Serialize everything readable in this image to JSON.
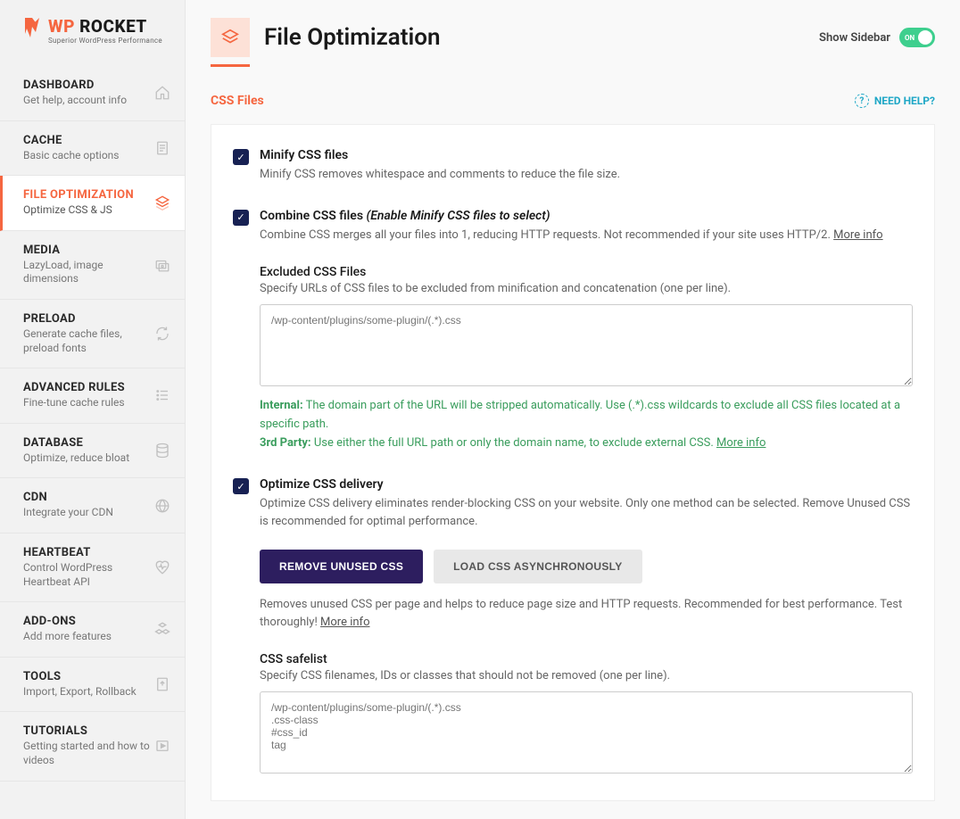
{
  "brand": {
    "name_wp": "WP",
    "name_rocket": " ROCKET",
    "tagline": "Superior WordPress Performance"
  },
  "nav": [
    {
      "title": "DASHBOARD",
      "sub": "Get help, account info",
      "key": "dashboard"
    },
    {
      "title": "CACHE",
      "sub": "Basic cache options",
      "key": "cache"
    },
    {
      "title": "FILE OPTIMIZATION",
      "sub": "Optimize CSS & JS",
      "key": "file-optimization",
      "active": true
    },
    {
      "title": "MEDIA",
      "sub": "LazyLoad, image dimensions",
      "key": "media"
    },
    {
      "title": "PRELOAD",
      "sub": "Generate cache files, preload fonts",
      "key": "preload"
    },
    {
      "title": "ADVANCED RULES",
      "sub": "Fine-tune cache rules",
      "key": "advanced-rules"
    },
    {
      "title": "DATABASE",
      "sub": "Optimize, reduce bloat",
      "key": "database"
    },
    {
      "title": "CDN",
      "sub": "Integrate your CDN",
      "key": "cdn"
    },
    {
      "title": "HEARTBEAT",
      "sub": "Control WordPress Heartbeat API",
      "key": "heartbeat"
    },
    {
      "title": "ADD-ONS",
      "sub": "Add more features",
      "key": "addons"
    },
    {
      "title": "TOOLS",
      "sub": "Import, Export, Rollback",
      "key": "tools"
    },
    {
      "title": "TUTORIALS",
      "sub": "Getting started and how to videos",
      "key": "tutorials"
    }
  ],
  "header": {
    "title": "File Optimization",
    "show_sidebar": "Show Sidebar",
    "toggle_on": "ON"
  },
  "section": {
    "title": "CSS Files",
    "help": "NEED HELP?"
  },
  "options": {
    "minify": {
      "title": "Minify CSS files",
      "desc": "Minify CSS removes whitespace and comments to reduce the file size."
    },
    "combine": {
      "title": "Combine CSS files ",
      "hint": "(Enable Minify CSS files to select)",
      "desc": "Combine CSS merges all your files into 1, reducing HTTP requests. Not recommended if your site uses HTTP/2. ",
      "more": "More info",
      "excluded": {
        "title": "Excluded CSS Files",
        "desc": "Specify URLs of CSS files to be excluded from minification and concatenation (one per line).",
        "placeholder": "/wp-content/plugins/some-plugin/(.*).css",
        "note_internal_label": "Internal:",
        "note_internal": " The domain part of the URL will be stripped automatically. Use (.*).css wildcards to exclude all CSS files located at a specific path.",
        "note_3rd_label": "3rd Party:",
        "note_3rd": " Use either the full URL path or only the domain name, to exclude external CSS. ",
        "note_more": "More info"
      }
    },
    "optimize": {
      "title": "Optimize CSS delivery",
      "desc": "Optimize CSS delivery eliminates render-blocking CSS on your website. Only one method can be selected. Remove Unused CSS is recommended for optimal performance.",
      "btn_remove": "REMOVE UNUSED CSS",
      "btn_async": "LOAD CSS ASYNCHRONOUSLY",
      "btn_desc": "Removes unused CSS per page and helps to reduce page size and HTTP requests. Recommended for best performance. Test thoroughly! ",
      "btn_more": "More info",
      "safelist": {
        "title": "CSS safelist",
        "desc": "Specify CSS filenames, IDs or classes that should not be removed (one per line).",
        "placeholder": "/wp-content/plugins/some-plugin/(.*).css\n.css-class\n#css_id\ntag"
      }
    }
  },
  "colors": {
    "accent": "#f56640",
    "primary_dark": "#2d1e5f",
    "check": "#172153",
    "green": "#3a9d5d",
    "cyan": "#1ea7c6",
    "toggle": "#3ecf8e"
  }
}
